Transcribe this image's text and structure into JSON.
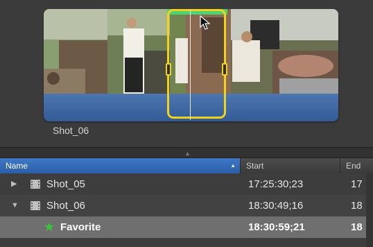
{
  "clip": {
    "label": "Shot_06"
  },
  "table": {
    "columns": {
      "name": "Name",
      "start": "Start",
      "end": "End"
    },
    "rows": [
      {
        "name": "Shot_05",
        "start": "17:25:30;23",
        "end": "17",
        "expanded": false
      },
      {
        "name": "Shot_06",
        "start": "18:30:49;16",
        "end": "18",
        "expanded": true
      },
      {
        "name": "Favorite",
        "start": "18:30:59;21",
        "end": "18",
        "selected": true
      }
    ]
  },
  "colors": {
    "selection": "#f2d21d",
    "favorite_bar": "#4fd36f",
    "audio_waveform": "#4d76b1",
    "header_accent": "#3f78c6",
    "favorite_star": "#39c43c"
  },
  "icons": {
    "sort": "triangle-up",
    "row_collapsed": "disclosure-right",
    "row_expanded": "disclosure-down",
    "clip": "filmstrip",
    "favorite": "star"
  }
}
